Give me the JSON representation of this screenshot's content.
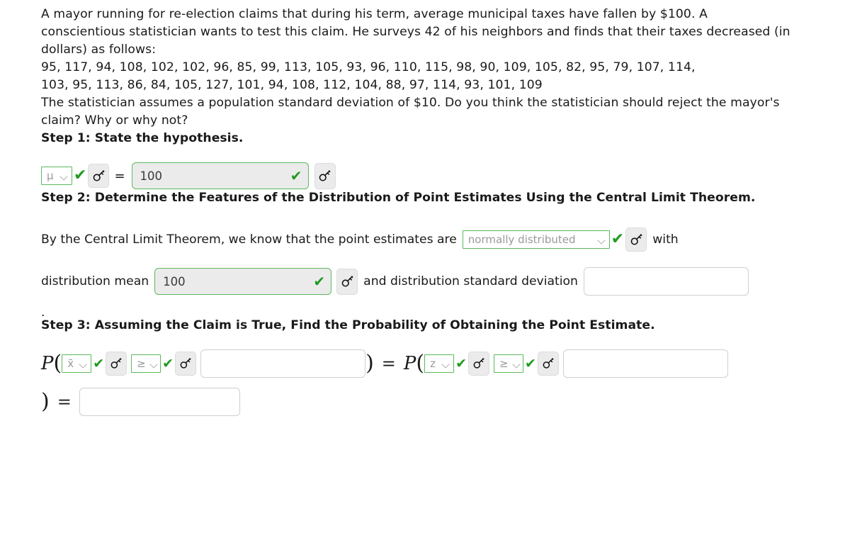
{
  "problem": {
    "paragraph1": "A mayor running for re-election claims that during his term, average municipal taxes have fallen by $100. A conscientious statistician wants to test this claim. He surveys 42 of his neighbors and finds that their taxes decreased (in dollars) as follows:",
    "data_line1": "95, 117, 94, 108, 102, 102, 96, 85, 99, 113, 105, 93, 96, 110, 115, 98, 90, 109, 105, 82, 95, 79, 107, 114,",
    "data_line2": "103, 95, 113, 86, 84, 105, 127, 101, 94, 108, 112, 104, 88, 97, 114, 93, 101, 109",
    "paragraph2": "The statistician assumes a population standard deviation of $10. Do you think the statistician should reject the mayor's claim? Why or why not?"
  },
  "step1": {
    "heading": "Step 1: State the hypothesis.",
    "param_select_value": "μ",
    "equals_label": "=",
    "value_input": "100",
    "value_input_placeholder": "",
    "key_icon": "key-icon",
    "check_icon": "✔"
  },
  "step2": {
    "heading": "Step 2: Determine the Features of the Distribution of Point Estimates Using the Central Limit Theorem.",
    "text_before": "By the Central Limit Theorem, we know that the point estimates are",
    "distribution_select_value": "normally distributed",
    "text_after": "with",
    "mean_label": "distribution mean",
    "mean_input": "100",
    "sd_label": "and distribution standard deviation",
    "sd_input": "",
    "sd_input_placeholder": "",
    "trailing_period": "."
  },
  "step3": {
    "heading": "Step 3: Assuming the Claim is True, Find the Probability of Obtaining the Point Estimate.",
    "p_symbol": "P",
    "open_paren": "(",
    "close_paren": ")",
    "equals": "=",
    "left": {
      "statistic_select_value": "x̄",
      "comparator_select_value": "≥",
      "value_input": "",
      "value_input_placeholder": ""
    },
    "right": {
      "statistic_select_value": "z",
      "comparator_select_value": "≥",
      "value_input": "",
      "value_input_placeholder": ""
    },
    "result_input": "",
    "result_input_placeholder": ""
  },
  "colors": {
    "valid_green": "#5cb85c",
    "check_green": "#1f9b1f",
    "input_border": "#cfcfcf",
    "input_valid_bg": "#ebebeb",
    "key_button_bg": "#ebebeb",
    "text": "#1a1a1a",
    "muted_text": "#9a9a9a"
  }
}
